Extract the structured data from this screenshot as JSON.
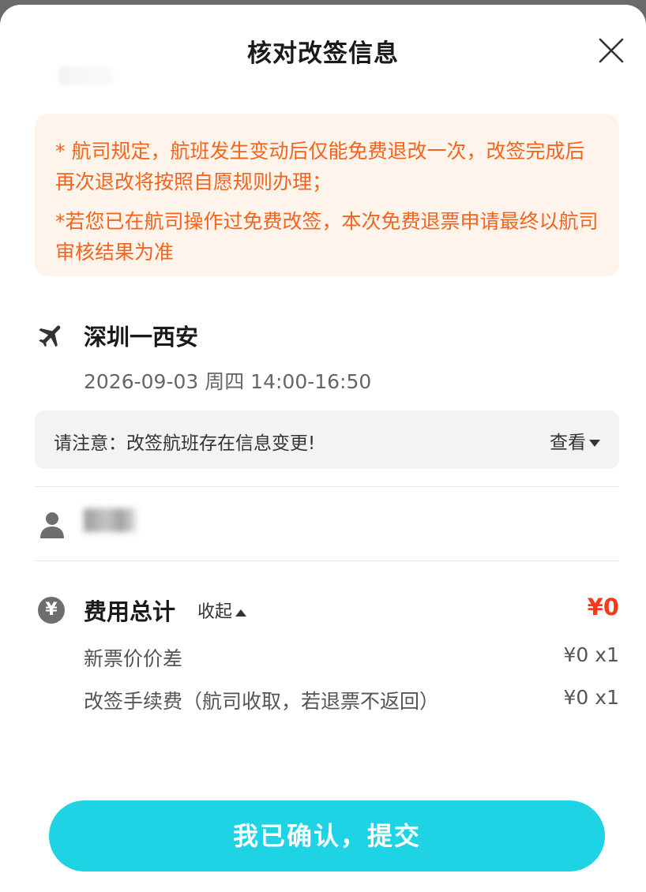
{
  "header": {
    "title": "核对改签信息"
  },
  "notice": {
    "line1": "* 航司规定，航班发生变动后仅能免费退改一次，改签完成后再次退改将按照自愿规则办理；",
    "line2": "*若您已在航司操作过免费改签，本次免费退票申请最终以航司审核结果为准"
  },
  "flight": {
    "route": "深圳一西安",
    "datetime": "2026-09-03 周四 14:00-16:50"
  },
  "change_notice": {
    "text": "请注意：改签航班存在信息变更!",
    "view_label": "查看"
  },
  "fees": {
    "total_label": "费用总计",
    "collapse_label": "收起",
    "total_amount": "¥0",
    "items": [
      {
        "label": "新票价价差",
        "amount": "¥0 x1"
      },
      {
        "label": "改签手续费（航司收取，若退票不返回）",
        "amount": "¥0 x1"
      }
    ]
  },
  "footer": {
    "confirm_label": "我已确认，提交"
  },
  "colors": {
    "accent": "#1ed4e4",
    "warning": "#f4641c",
    "price": "#f53a1a"
  },
  "icons": [
    "close-icon",
    "plane-icon",
    "person-icon",
    "yen-icon",
    "caret-down-icon",
    "caret-up-icon"
  ]
}
